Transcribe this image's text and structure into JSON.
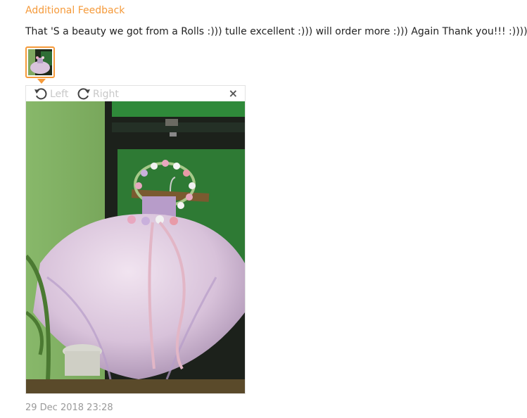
{
  "feedback": {
    "title": "Additional Feedback",
    "text": "That 'S a beauty we got from a Rolls :))) tulle excellent :))) will order more :))) Again Thank you!!! :))))))",
    "date": "29 Dec 2018 23:28"
  },
  "viewer": {
    "rotate_left_label": "Left",
    "rotate_right_label": "Right",
    "close_label": "×",
    "rotate_left_icon": "rotate-ccw-icon",
    "rotate_right_icon": "rotate-cw-icon",
    "close_icon": "close-icon"
  },
  "colors": {
    "accent": "#f59a3a",
    "text": "#222222",
    "muted": "#9a9a9a"
  }
}
